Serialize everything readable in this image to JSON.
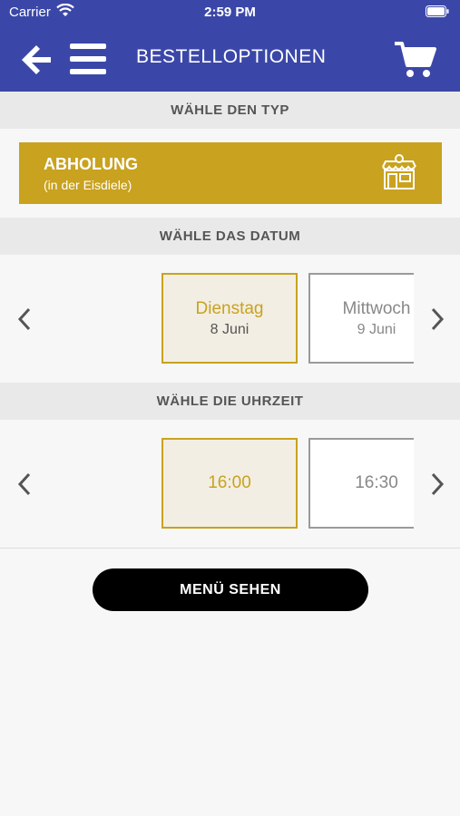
{
  "status_bar": {
    "carrier": "Carrier",
    "time": "2:59 PM"
  },
  "header": {
    "title": "BESTELLOPTIONEN",
    "back_icon": "arrow-left-icon",
    "menu_icon": "hamburger-icon",
    "cart_icon": "cart-icon"
  },
  "type_section": {
    "header": "WÄHLE DEN TYP",
    "selected": {
      "title": "ABHOLUNG",
      "subtitle": "(in der Eisdiele)",
      "icon": "shop-icon"
    }
  },
  "date_section": {
    "header": "WÄHLE DAS DATUM",
    "options": [
      {
        "day": "Dienstag",
        "date": "8 Juni",
        "selected": true
      },
      {
        "day": "Mittwoch",
        "date": "9 Juni",
        "selected": false
      }
    ]
  },
  "time_section": {
    "header": "WÄHLE DIE UHRZEIT",
    "options": [
      {
        "time": "16:00",
        "selected": true
      },
      {
        "time": "16:30",
        "selected": false
      }
    ]
  },
  "actions": {
    "menu_label": "MENÜ SEHEN"
  },
  "colors": {
    "primary": "#3b47a8",
    "accent": "#c9a21f",
    "button": "#000000"
  }
}
